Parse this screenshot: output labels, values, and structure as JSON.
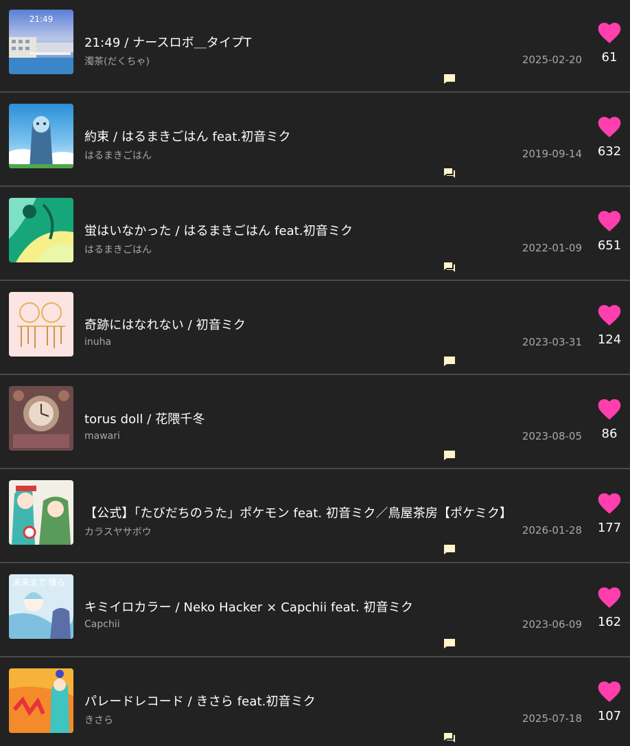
{
  "colors": {
    "background": "#222222",
    "divider": "#4a4a4a",
    "heart": "#ff3fae",
    "comment_icon": "#fff5c8",
    "title": "#ffffff",
    "secondary": "#a8a8a8"
  },
  "songs": [
    {
      "title": "21:49 / ナースロボ＿タイプT",
      "artist": "濁茶(だくちゃ)",
      "date": "2025-02-20",
      "likes": "61",
      "thumb_text": "21:49"
    },
    {
      "title": "約束 / はるまきごはん feat.初音ミク",
      "artist": "はるまきごはん",
      "date": "2019-09-14",
      "likes": "632"
    },
    {
      "title": "蛍はいなかった / はるまきごはん feat.初音ミク",
      "artist": "はるまきごはん",
      "date": "2022-01-09",
      "likes": "651"
    },
    {
      "title": "奇跡にはなれない / 初音ミク",
      "artist": "inuha",
      "date": "2023-03-31",
      "likes": "124"
    },
    {
      "title": "torus doll / 花隈千冬",
      "artist": "mawari",
      "date": "2023-08-05",
      "likes": "86"
    },
    {
      "title": "【公式】「たびだちのうた」ポケモン feat. 初音ミク／鳥屋茶房【ポケミク】",
      "artist": "カラスヤサボウ",
      "date": "2026-01-28",
      "likes": "177"
    },
    {
      "title": "キミイロカラー / Neko Hacker × Capchii feat. 初音ミク",
      "artist": "Capchii",
      "date": "2023-06-09",
      "likes": "162",
      "thumb_text": "未来まで 僕ら"
    },
    {
      "title": "パレードレコード / きさら feat.初音ミク",
      "artist": "きさら",
      "date": "2025-07-18",
      "likes": "107"
    }
  ]
}
